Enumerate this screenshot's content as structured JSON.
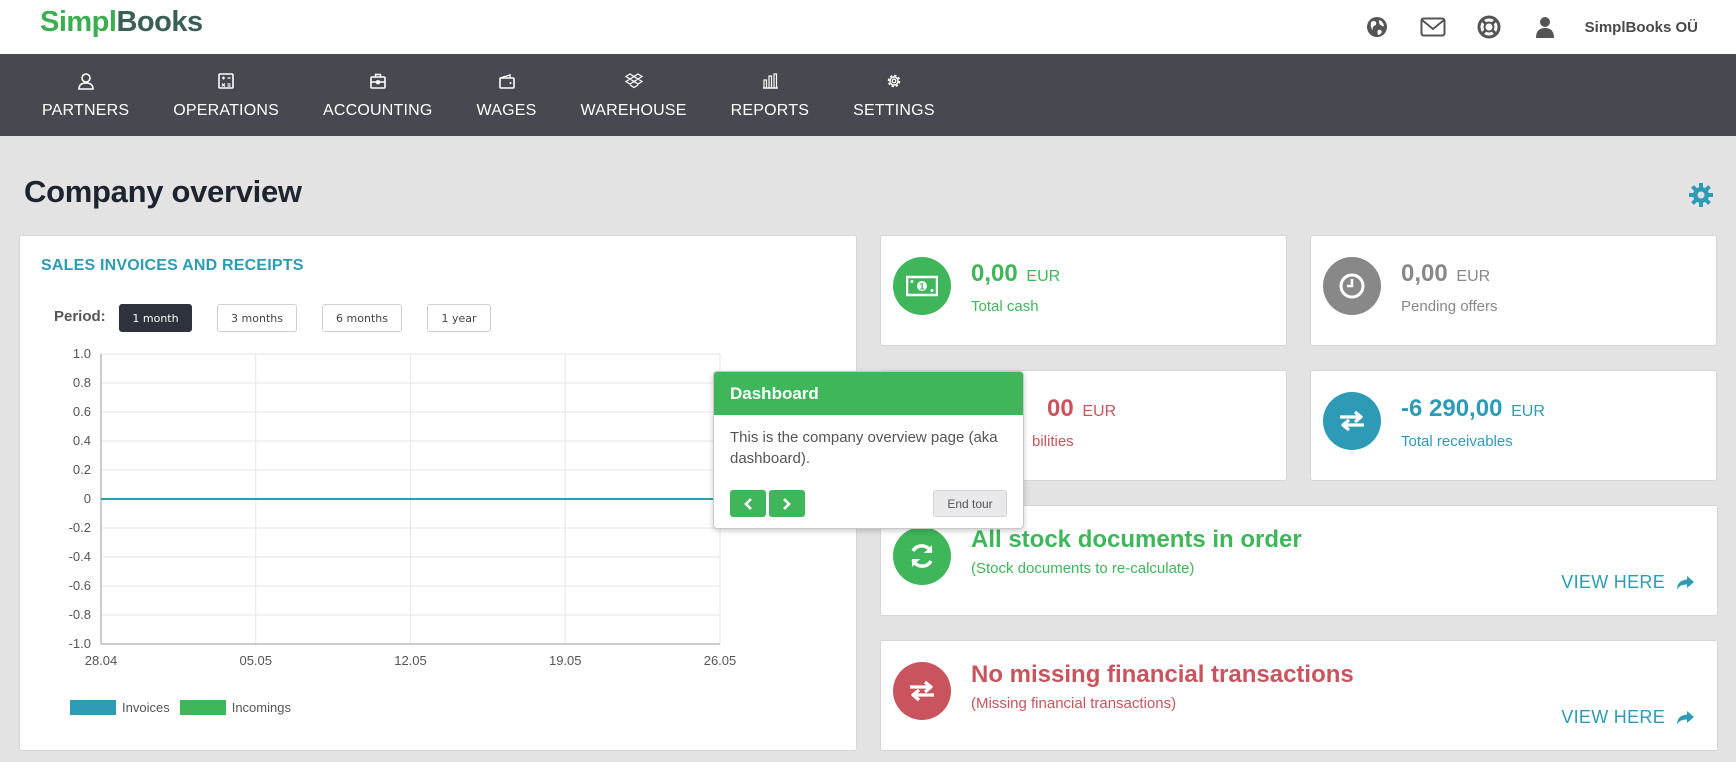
{
  "header": {
    "logo_part1": "Simpl",
    "logo_part2": "Books",
    "company": "SimplBooks OÜ",
    "icons": [
      "globe-icon",
      "envelope-icon",
      "lifebuoy-icon",
      "user-icon"
    ]
  },
  "nav": {
    "items": [
      {
        "label": "PARTNERS",
        "icon": "user-outline-icon"
      },
      {
        "label": "OPERATIONS",
        "icon": "calculator-icon"
      },
      {
        "label": "ACCOUNTING",
        "icon": "briefcase-icon"
      },
      {
        "label": "WAGES",
        "icon": "wallet-icon"
      },
      {
        "label": "WAREHOUSE",
        "icon": "dropbox-icon"
      },
      {
        "label": "REPORTS",
        "icon": "bar-chart-icon"
      },
      {
        "label": "SETTINGS",
        "icon": "gear-icon"
      }
    ]
  },
  "page": {
    "title": "Company overview"
  },
  "sales": {
    "title": "SALES INVOICES AND RECEIPTS",
    "period_label": "Period:",
    "periods": [
      "1 month",
      "3 months",
      "6 months",
      "1 year"
    ],
    "active_period": "1 month"
  },
  "chart_data": {
    "type": "line",
    "title": "",
    "xlabel": "",
    "ylabel": "",
    "categories": [
      "28.04",
      "05.05",
      "12.05",
      "19.05",
      "26.05"
    ],
    "yticks": [
      "1.0",
      "0.8",
      "0.6",
      "0.4",
      "0.2",
      "0",
      "-0.2",
      "-0.4",
      "-0.6",
      "-0.8",
      "-1.0"
    ],
    "ylim": [
      -1,
      1
    ],
    "grid": true,
    "series": [
      {
        "name": "Invoices",
        "color": "#2e9bb6",
        "values": [
          0,
          0,
          0,
          0,
          0
        ]
      },
      {
        "name": "Incomings",
        "color": "#3fb65a",
        "values": [
          0,
          0,
          0,
          0,
          0
        ]
      }
    ],
    "legend": "bottom-left"
  },
  "stats": {
    "cash": {
      "value": "0,00",
      "currency": "EUR",
      "label": "Total cash",
      "color": "#3fb65a"
    },
    "offers": {
      "value": "0,00",
      "currency": "EUR",
      "label": "Pending offers",
      "color": "#888888"
    },
    "liabilities": {
      "value": "00",
      "currency": "EUR",
      "label": "bilities",
      "color": "#c9545d"
    },
    "receivables": {
      "value": "-6 290,00",
      "currency": "EUR",
      "label": "Total receivables",
      "color": "#2e9bb6"
    }
  },
  "stock": {
    "title": "All stock documents in order",
    "sub": "(Stock documents to re-calculate)",
    "link": "VIEW HERE"
  },
  "financial": {
    "title": "No missing financial transactions",
    "sub": "(Missing financial transactions)",
    "link": "VIEW HERE"
  },
  "tour": {
    "title": "Dashboard",
    "body": "This is the company overview page (aka dashboard).",
    "end_label": "End tour"
  }
}
